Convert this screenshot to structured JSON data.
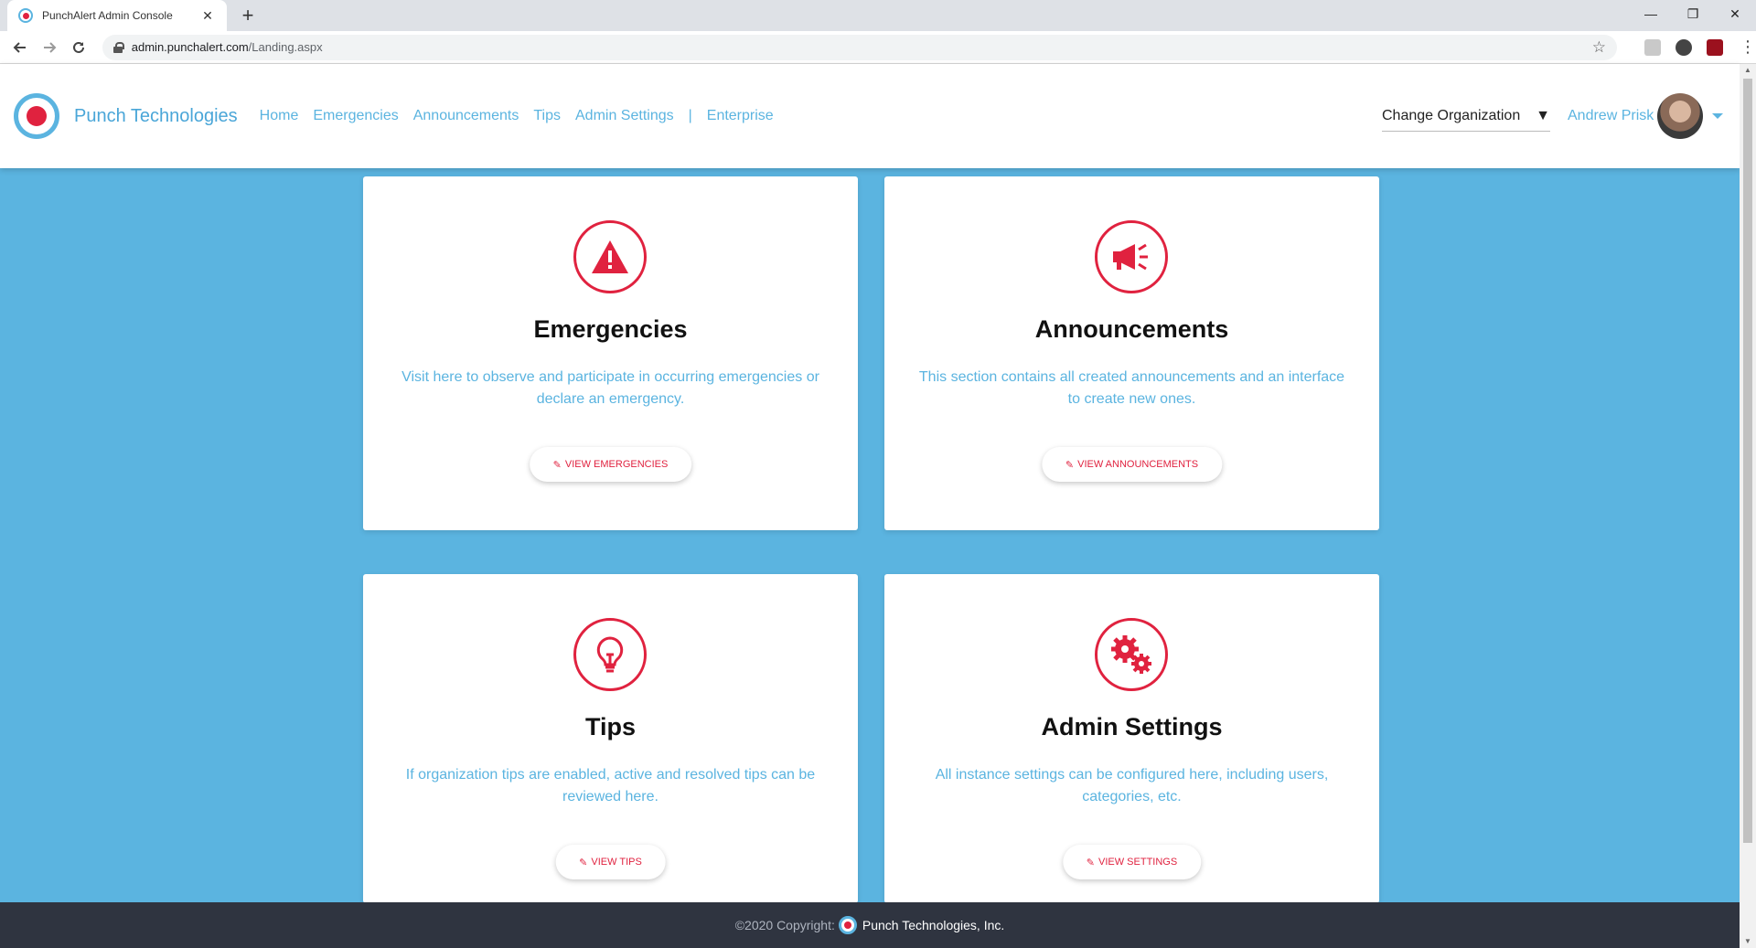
{
  "browser": {
    "tab_title": "PunchAlert Admin Console",
    "tab_close": "✕",
    "new_tab": "+",
    "url_host": "admin.punchalert.com",
    "url_path": "/Landing.aspx",
    "controls": {
      "minimize": "—",
      "restore": "❐",
      "close": "✕"
    }
  },
  "header": {
    "brand": "Punch Technologies",
    "nav": [
      {
        "label": "Home"
      },
      {
        "label": "Emergencies"
      },
      {
        "label": "Announcements"
      },
      {
        "label": "Tips"
      },
      {
        "label": "Admin Settings"
      },
      {
        "label": "Enterprise"
      }
    ],
    "nav_separator": "|",
    "org_select": {
      "value": "Change Organization"
    },
    "user_name": "Andrew Prisk"
  },
  "cards": [
    {
      "icon": "warning-icon",
      "title": "Emergencies",
      "description": "Visit here to observe and participate in occurring emergencies or declare an emergency.",
      "button": "VIEW EMERGENCIES"
    },
    {
      "icon": "megaphone-icon",
      "title": "Announcements",
      "description": "This section contains all created announcements and an interface to create new ones.",
      "button": "VIEW ANNOUNCEMENTS"
    },
    {
      "icon": "lightbulb-icon",
      "title": "Tips",
      "description": "If organization tips are enabled, active and resolved tips can be reviewed here.",
      "button": "VIEW TIPS"
    },
    {
      "icon": "gears-icon",
      "title": "Admin Settings",
      "description": "All instance settings can be configured here, including users, categories, etc.",
      "button": "VIEW SETTINGS"
    }
  ],
  "footer": {
    "copyright": "©2020 Copyright:",
    "company": "Punch Technologies, Inc."
  },
  "colors": {
    "accent_blue": "#5bb4e0",
    "accent_red": "#e0223f",
    "footer_bg": "#2f3440"
  }
}
